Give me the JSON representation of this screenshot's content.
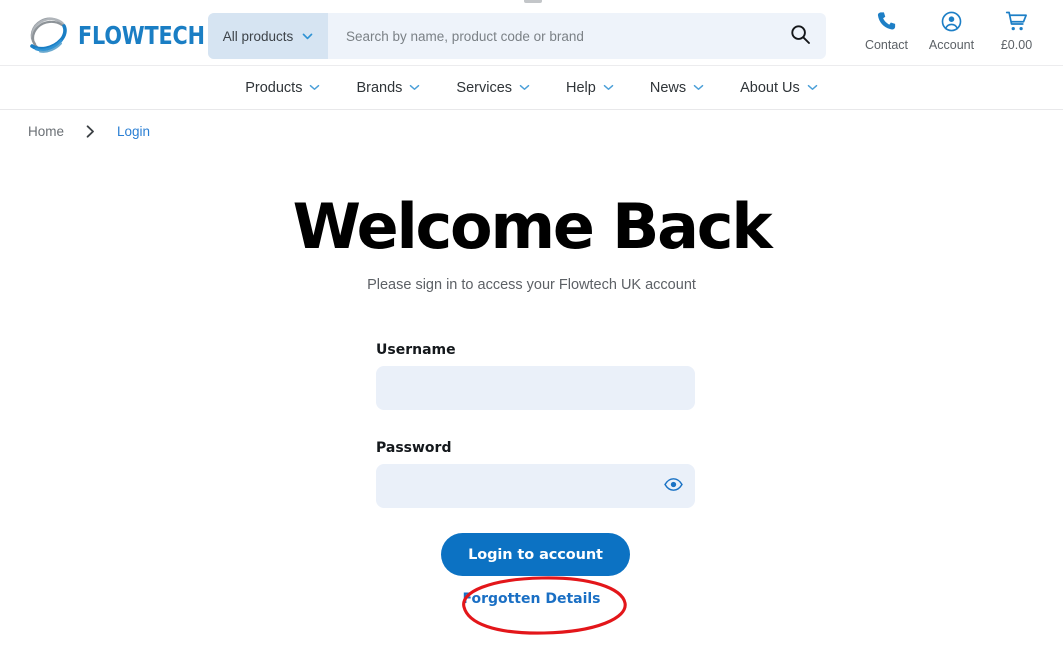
{
  "brand": {
    "name": "FLOWTECH",
    "logo_icon": "globe-swoosh-logo",
    "accent_blue": "#1a7ec4",
    "logo_gray": "#9aa0a6"
  },
  "header": {
    "search": {
      "category_label": "All products",
      "category_caret_icon": "chevron-down-icon",
      "placeholder": "Search by name, product code or brand",
      "value": "",
      "submit_icon": "search-icon"
    },
    "utilities": [
      {
        "label": "Contact",
        "icon": "phone-icon"
      },
      {
        "label": "Account",
        "icon": "account-circle-icon"
      },
      {
        "label": "£0.00",
        "icon": "shopping-cart-icon"
      }
    ]
  },
  "nav": {
    "items": [
      {
        "label": "Products",
        "caret_icon": "chevron-down-icon"
      },
      {
        "label": "Brands",
        "caret_icon": "chevron-down-icon"
      },
      {
        "label": "Services",
        "caret_icon": "chevron-down-icon"
      },
      {
        "label": "Help",
        "caret_icon": "chevron-down-icon"
      },
      {
        "label": "News",
        "caret_icon": "chevron-down-icon"
      },
      {
        "label": "About Us",
        "caret_icon": "chevron-down-icon"
      }
    ]
  },
  "breadcrumb": {
    "home": "Home",
    "separator_icon": "chevron-right-icon",
    "current": "Login"
  },
  "main": {
    "title": "Welcome Back",
    "subtitle": "Please sign in to access your Flowtech UK account",
    "form": {
      "username": {
        "label": "Username",
        "value": "",
        "placeholder": ""
      },
      "password": {
        "label": "Password",
        "value": "",
        "placeholder": "",
        "reveal_icon": "eye-icon"
      },
      "submit_label": "Login to account",
      "forgot_label": "Forgotten Details"
    }
  },
  "annotation": {
    "shape": "ellipse",
    "color": "#e3161a",
    "target": "Forgotten Details"
  }
}
